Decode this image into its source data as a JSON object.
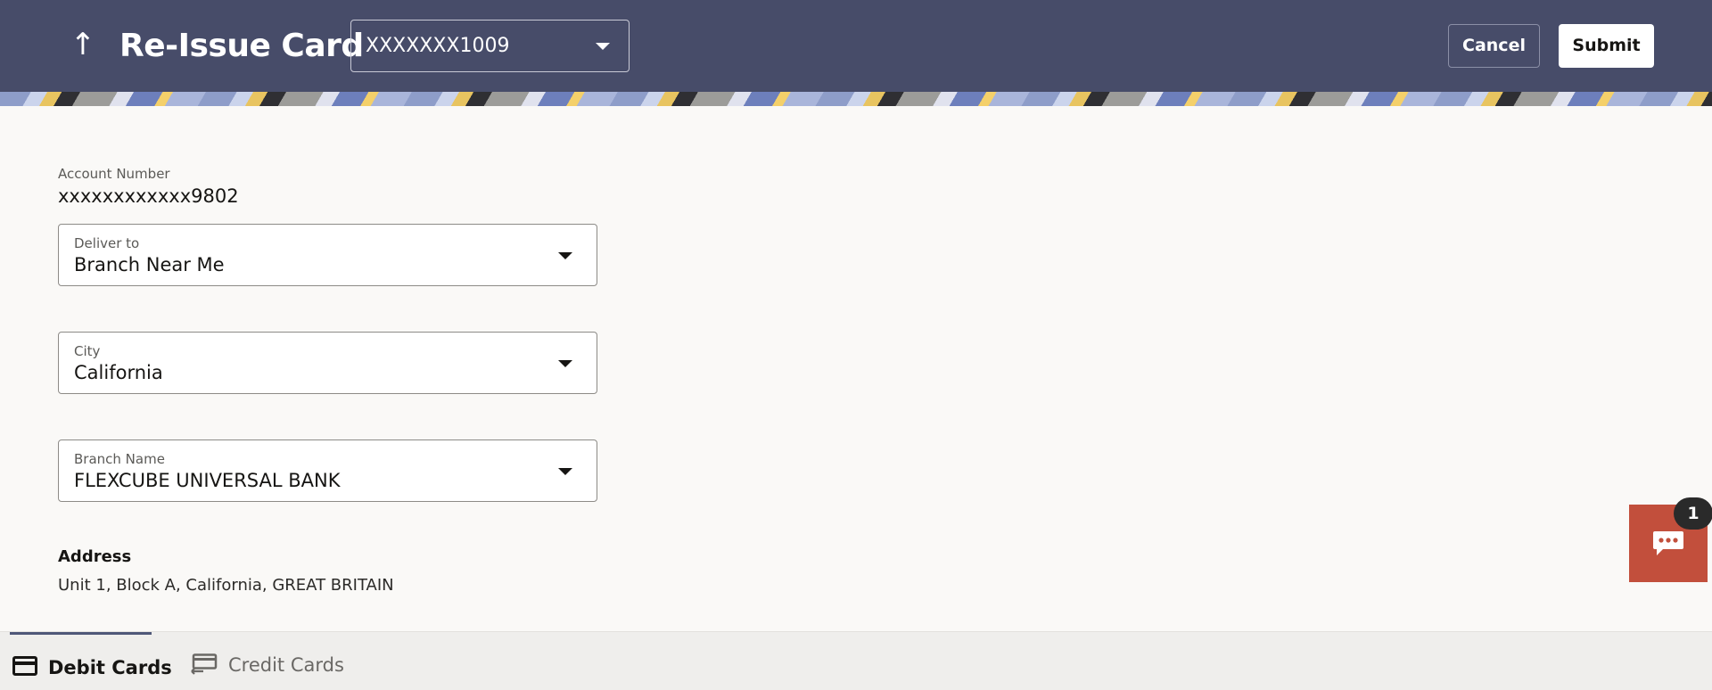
{
  "header": {
    "title": "Re-Issue Card",
    "card_select_value": "XXXXXXX1009",
    "cancel_label": "Cancel",
    "submit_label": "Submit",
    "background_color": "#474c69"
  },
  "form": {
    "account_number_label": "Account Number",
    "account_number_value": "xxxxxxxxxxxx9802",
    "deliver_to": {
      "label": "Deliver to",
      "value": "Branch Near Me"
    },
    "city": {
      "label": "City",
      "value": "California"
    },
    "branch_name": {
      "label": "Branch Name",
      "value": "FLEXCUBE UNIVERSAL BANK"
    },
    "address_label": "Address",
    "address_value": "Unit 1, Block A, California, GREAT BRITAIN"
  },
  "chat": {
    "icon": "chat-icon",
    "badge_count": "1",
    "color": "#c24f3c"
  },
  "bottom_tabs": [
    {
      "label": "Debit Cards",
      "icon": "card-icon",
      "active": true
    },
    {
      "label": "Credit Cards",
      "icon": "card-transfer-icon",
      "active": false
    }
  ]
}
